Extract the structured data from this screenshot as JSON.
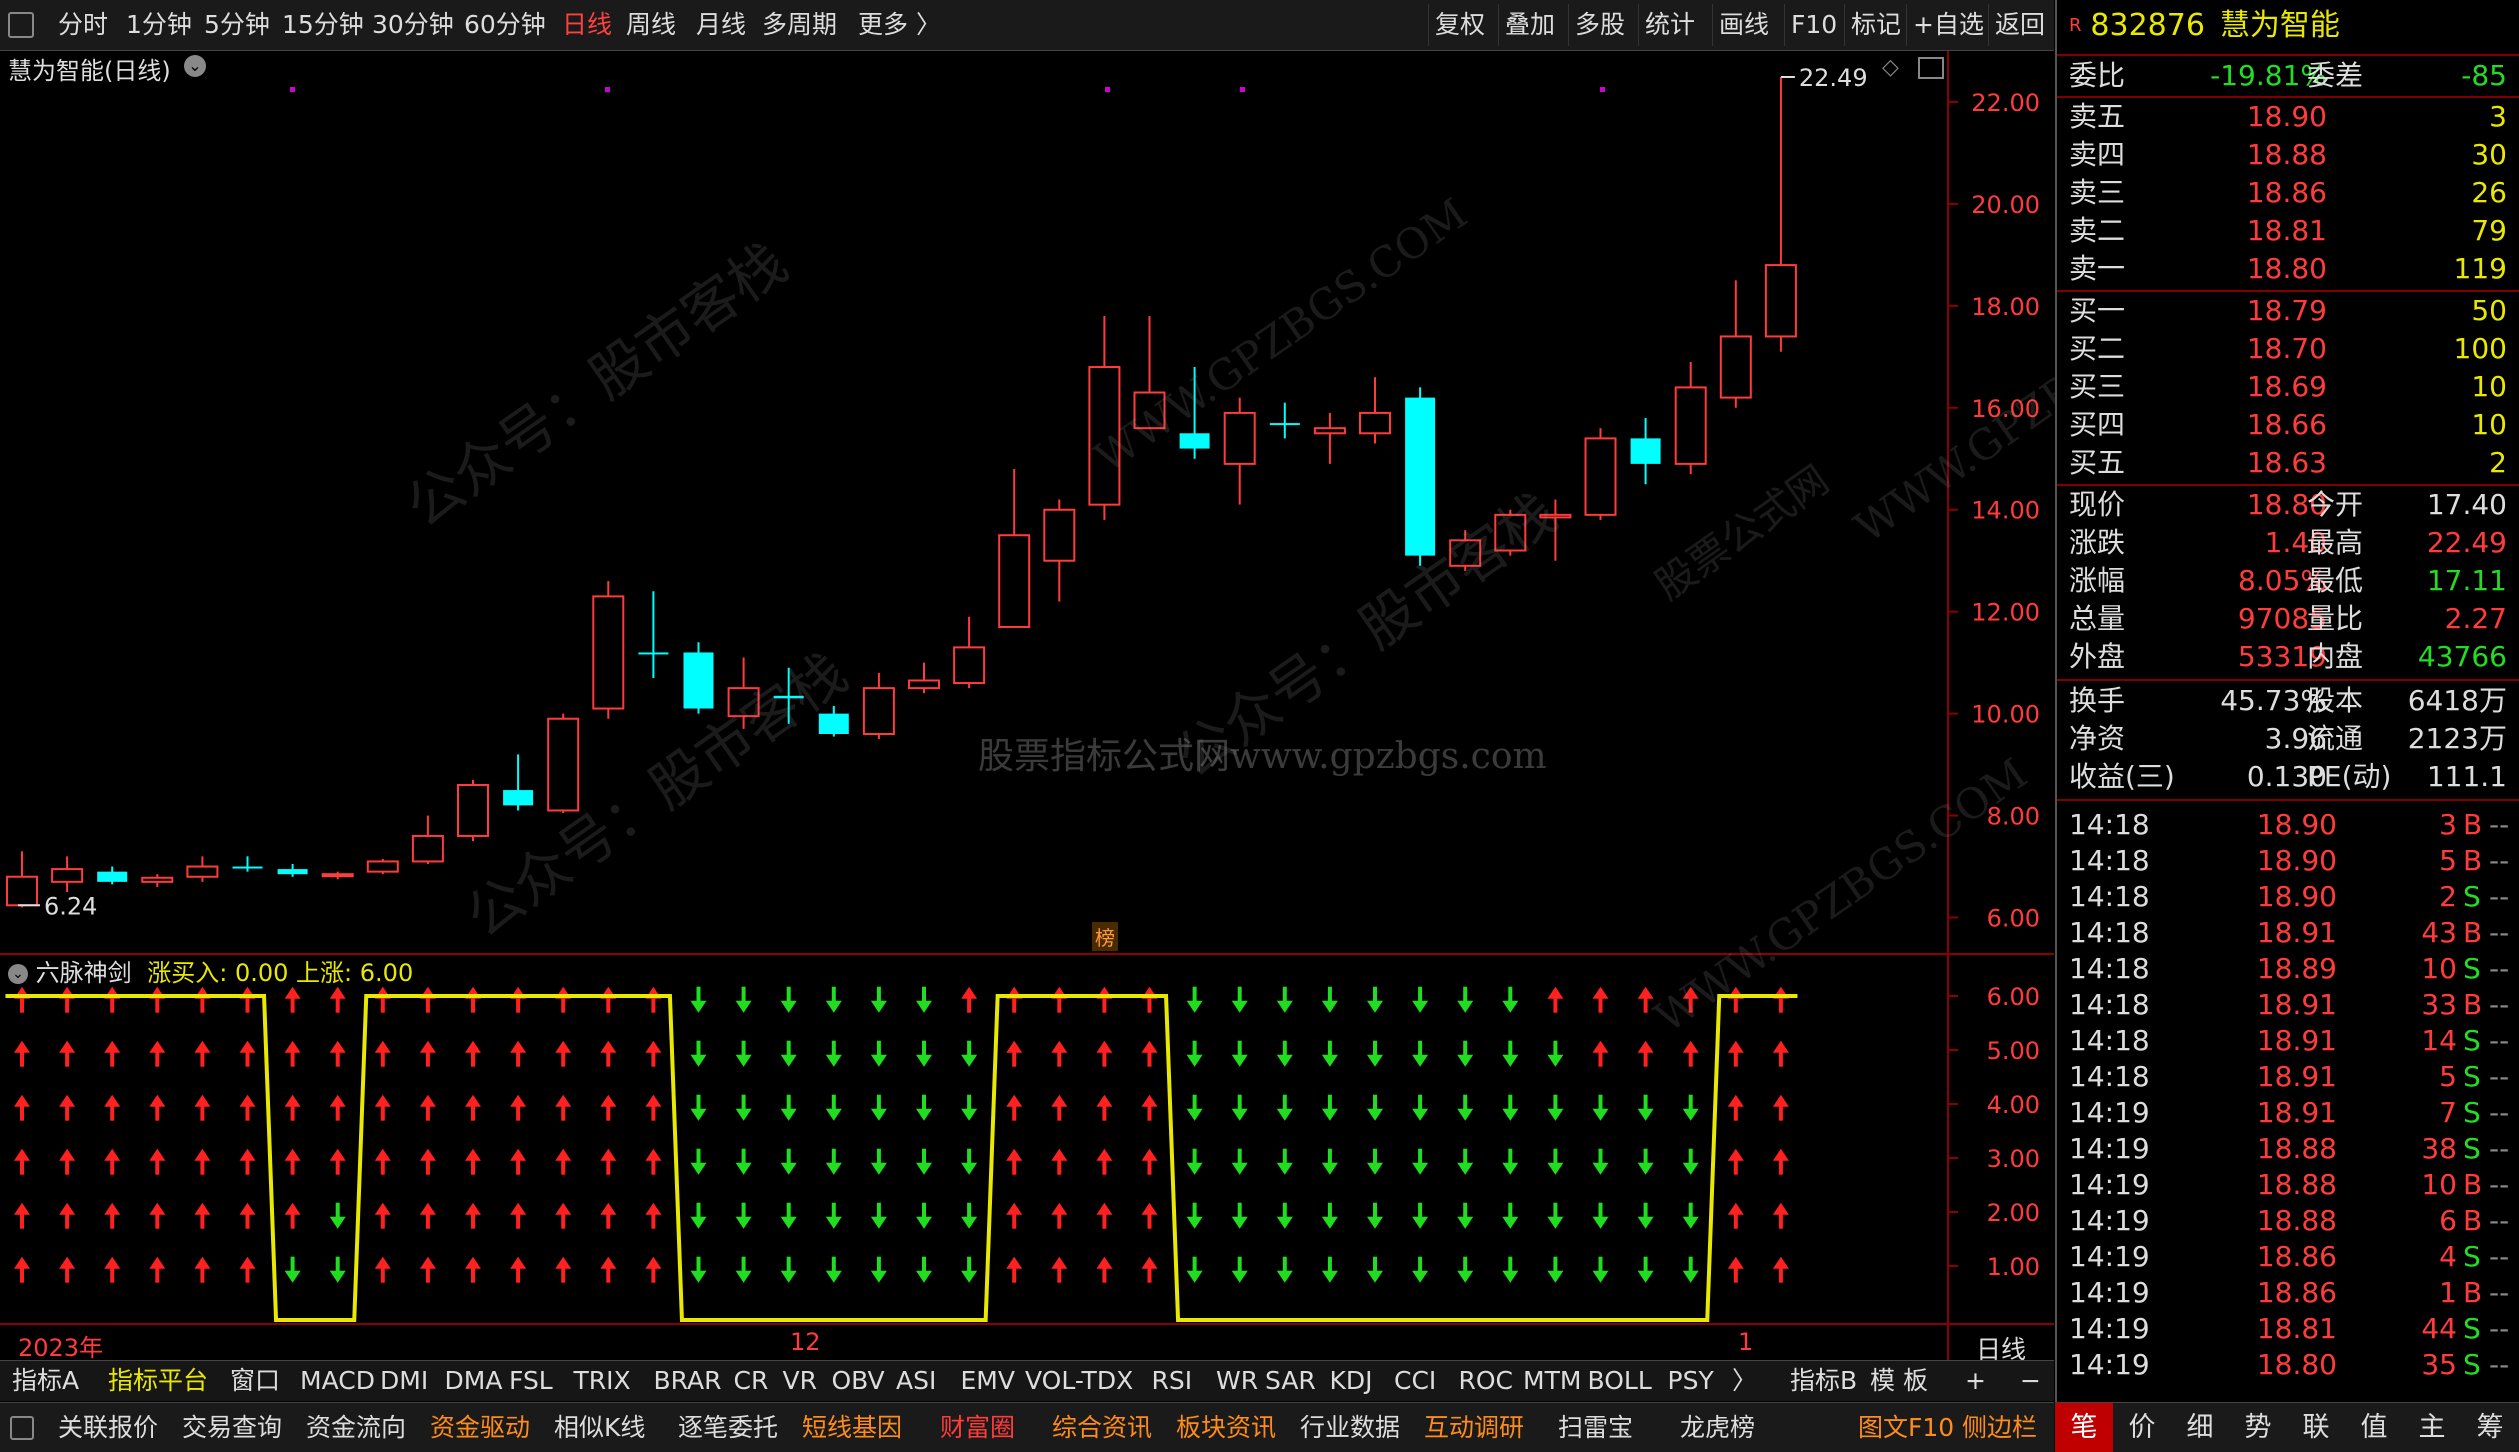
{
  "periods": [
    "分时",
    "1分钟",
    "5分钟",
    "15分钟",
    "30分钟",
    "60分钟",
    "日线",
    "周线",
    "月线",
    "多周期",
    "更多 〉"
  ],
  "active_period": "日线",
  "tools": [
    "复权",
    "叠加",
    "多股",
    "统计",
    "画线",
    "F10",
    "标记",
    "+自选",
    "返回"
  ],
  "chart_title": "慧为智能(日线)",
  "main_y_ticks": [
    "22.00",
    "20.00",
    "18.00",
    "16.00",
    "14.00",
    "12.00",
    "10.00",
    "8.00",
    "6.00"
  ],
  "high_label": "22.49",
  "low_label": "6.24",
  "watermark_center": "股票指标公式网www.gpzbgs.com",
  "watermarks": [
    "公众号：股市客栈",
    "WWW.GPZBGS.COM",
    "股票公式网"
  ],
  "bang_label": "榜",
  "indicator_title": "六脉神剑",
  "indicator_values": "涨买入: 0.00  上涨: 6.00",
  "ind_y_ticks": [
    "6.00",
    "5.00",
    "4.00",
    "3.00",
    "2.00",
    "1.00"
  ],
  "date_labels": {
    "start": "2023年",
    "mid": "12",
    "end": "1"
  },
  "date_tab": "日线",
  "chart_data": {
    "type": "candlestick",
    "ylim": [
      5.5,
      23
    ],
    "candles": [
      {
        "o": 6.24,
        "h": 7.3,
        "l": 6.2,
        "c": 6.8,
        "up": true
      },
      {
        "o": 6.7,
        "h": 7.2,
        "l": 6.5,
        "c": 6.95,
        "up": true
      },
      {
        "o": 6.9,
        "h": 7.0,
        "l": 6.65,
        "c": 6.7,
        "up": false
      },
      {
        "o": 6.7,
        "h": 6.85,
        "l": 6.6,
        "c": 6.78,
        "up": true
      },
      {
        "o": 6.8,
        "h": 7.2,
        "l": 6.7,
        "c": 7.0,
        "up": true
      },
      {
        "o": 7.0,
        "h": 7.2,
        "l": 6.9,
        "c": 7.0,
        "up": false
      },
      {
        "o": 6.95,
        "h": 7.05,
        "l": 6.8,
        "c": 6.85,
        "up": false
      },
      {
        "o": 6.82,
        "h": 6.9,
        "l": 6.75,
        "c": 6.85,
        "up": true
      },
      {
        "o": 6.9,
        "h": 7.15,
        "l": 6.85,
        "c": 7.1,
        "up": true
      },
      {
        "o": 7.1,
        "h": 8.0,
        "l": 7.05,
        "c": 7.6,
        "up": true
      },
      {
        "o": 7.6,
        "h": 8.7,
        "l": 7.5,
        "c": 8.6,
        "up": true
      },
      {
        "o": 8.5,
        "h": 9.2,
        "l": 8.1,
        "c": 8.2,
        "up": false
      },
      {
        "o": 8.1,
        "h": 10.0,
        "l": 8.05,
        "c": 9.9,
        "up": true
      },
      {
        "o": 10.1,
        "h": 12.6,
        "l": 9.9,
        "c": 12.3,
        "up": true
      },
      {
        "o": 11.2,
        "h": 12.4,
        "l": 10.7,
        "c": 11.2,
        "up": false
      },
      {
        "o": 11.2,
        "h": 11.4,
        "l": 10.0,
        "c": 10.1,
        "up": false
      },
      {
        "o": 9.95,
        "h": 11.1,
        "l": 9.7,
        "c": 10.5,
        "up": true
      },
      {
        "o": 10.35,
        "h": 10.9,
        "l": 9.8,
        "c": 10.3,
        "up": false
      },
      {
        "o": 10.0,
        "h": 10.15,
        "l": 9.55,
        "c": 9.6,
        "up": false
      },
      {
        "o": 9.6,
        "h": 10.8,
        "l": 9.5,
        "c": 10.5,
        "up": true
      },
      {
        "o": 10.5,
        "h": 11.0,
        "l": 10.4,
        "c": 10.65,
        "up": true
      },
      {
        "o": 10.6,
        "h": 11.9,
        "l": 10.5,
        "c": 11.3,
        "up": true
      },
      {
        "o": 11.7,
        "h": 14.8,
        "l": 11.7,
        "c": 13.5,
        "up": true
      },
      {
        "o": 13.0,
        "h": 14.2,
        "l": 12.2,
        "c": 14.0,
        "up": true
      },
      {
        "o": 14.1,
        "h": 17.8,
        "l": 13.8,
        "c": 16.8,
        "up": true
      },
      {
        "o": 15.6,
        "h": 17.8,
        "l": 15.6,
        "c": 16.3,
        "up": true
      },
      {
        "o": 15.5,
        "h": 16.8,
        "l": 15.0,
        "c": 15.2,
        "up": false
      },
      {
        "o": 14.9,
        "h": 16.2,
        "l": 14.1,
        "c": 15.9,
        "up": true
      },
      {
        "o": 15.7,
        "h": 16.1,
        "l": 15.4,
        "c": 15.7,
        "up": false
      },
      {
        "o": 15.6,
        "h": 15.9,
        "l": 14.9,
        "c": 15.5,
        "up": true
      },
      {
        "o": 15.5,
        "h": 16.6,
        "l": 15.3,
        "c": 15.9,
        "up": true
      },
      {
        "o": 16.2,
        "h": 16.4,
        "l": 12.9,
        "c": 13.1,
        "up": false
      },
      {
        "o": 12.9,
        "h": 13.6,
        "l": 12.8,
        "c": 13.4,
        "up": true
      },
      {
        "o": 13.2,
        "h": 14.0,
        "l": 13.1,
        "c": 13.9,
        "up": true
      },
      {
        "o": 13.85,
        "h": 14.2,
        "l": 13.0,
        "c": 13.9,
        "up": true
      },
      {
        "o": 13.9,
        "h": 15.6,
        "l": 13.8,
        "c": 15.4,
        "up": true
      },
      {
        "o": 15.4,
        "h": 15.8,
        "l": 14.5,
        "c": 14.9,
        "up": false
      },
      {
        "o": 14.9,
        "h": 16.9,
        "l": 14.7,
        "c": 16.4,
        "up": true
      },
      {
        "o": 16.2,
        "h": 18.5,
        "l": 16.0,
        "c": 17.4,
        "up": true
      },
      {
        "o": 17.4,
        "h": 22.49,
        "l": 17.1,
        "c": 18.8,
        "up": true
      }
    ],
    "indicator": {
      "name": "六脉神剑",
      "ylim": [
        0,
        6
      ],
      "values": [
        6,
        6,
        6,
        6,
        6,
        6,
        0,
        0,
        6,
        6,
        6,
        6,
        6,
        6,
        6,
        0,
        0,
        0,
        0,
        0,
        0,
        0,
        6,
        6,
        6,
        6,
        0,
        0,
        0,
        0,
        0,
        0,
        0,
        0,
        0,
        0,
        0,
        0,
        6,
        6
      ],
      "red_counts": [
        6,
        6,
        6,
        6,
        6,
        6,
        5,
        4,
        6,
        6,
        6,
        6,
        6,
        6,
        6,
        0,
        0,
        0,
        0,
        0,
        0,
        1,
        6,
        6,
        6,
        6,
        0,
        0,
        0,
        0,
        0,
        0,
        0,
        0,
        1,
        2,
        2,
        2,
        6,
        6
      ]
    }
  },
  "quote": {
    "code": "832876",
    "name": "慧为智能",
    "weibi_label": "委比",
    "weibi": "-19.81%",
    "weicha_label": "委差",
    "weicha": "-85",
    "asks": [
      {
        "label": "卖五",
        "price": "18.90",
        "vol": "3"
      },
      {
        "label": "卖四",
        "price": "18.88",
        "vol": "30"
      },
      {
        "label": "卖三",
        "price": "18.86",
        "vol": "26"
      },
      {
        "label": "卖二",
        "price": "18.81",
        "vol": "79"
      },
      {
        "label": "卖一",
        "price": "18.80",
        "vol": "119"
      }
    ],
    "bids": [
      {
        "label": "买一",
        "price": "18.79",
        "vol": "50"
      },
      {
        "label": "买二",
        "price": "18.70",
        "vol": "100"
      },
      {
        "label": "买三",
        "price": "18.69",
        "vol": "10"
      },
      {
        "label": "买四",
        "price": "18.66",
        "vol": "10"
      },
      {
        "label": "买五",
        "price": "18.63",
        "vol": "2"
      }
    ],
    "stats": [
      {
        "l1": "现价",
        "v1": "18.80",
        "c1": "red",
        "l2": "今开",
        "v2": "17.40",
        "c2": "white"
      },
      {
        "l1": "涨跌",
        "v1": "1.40",
        "c1": "red",
        "l2": "最高",
        "v2": "22.49",
        "c2": "red"
      },
      {
        "l1": "涨幅",
        "v1": "8.05%",
        "c1": "red",
        "l2": "最低",
        "v2": "17.11",
        "c2": "green"
      },
      {
        "l1": "总量",
        "v1": "97085",
        "c1": "red",
        "l2": "量比",
        "v2": "2.27",
        "c2": "red"
      },
      {
        "l1": "外盘",
        "v1": "53319",
        "c1": "red",
        "l2": "内盘",
        "v2": "43766",
        "c2": "green"
      }
    ],
    "stats2": [
      {
        "l1": "换手",
        "v1": "45.73%",
        "l2": "股本",
        "v2": "6418万"
      },
      {
        "l1": "净资",
        "v1": "3.96",
        "l2": "流通",
        "v2": "2123万"
      },
      {
        "l1": "收益(三)",
        "v1": "0.130",
        "l2": "PE(动)",
        "v2": "111.1"
      }
    ],
    "ticks": [
      {
        "t": "14:18",
        "p": "18.90",
        "v": "3",
        "s": "B"
      },
      {
        "t": "14:18",
        "p": "18.90",
        "v": "5",
        "s": "B"
      },
      {
        "t": "14:18",
        "p": "18.90",
        "v": "2",
        "s": "S"
      },
      {
        "t": "14:18",
        "p": "18.91",
        "v": "43",
        "s": "B"
      },
      {
        "t": "14:18",
        "p": "18.89",
        "v": "10",
        "s": "S"
      },
      {
        "t": "14:18",
        "p": "18.91",
        "v": "33",
        "s": "B"
      },
      {
        "t": "14:18",
        "p": "18.91",
        "v": "14",
        "s": "S"
      },
      {
        "t": "14:18",
        "p": "18.91",
        "v": "5",
        "s": "S"
      },
      {
        "t": "14:19",
        "p": "18.91",
        "v": "7",
        "s": "S"
      },
      {
        "t": "14:19",
        "p": "18.88",
        "v": "38",
        "s": "S"
      },
      {
        "t": "14:19",
        "p": "18.88",
        "v": "10",
        "s": "B"
      },
      {
        "t": "14:19",
        "p": "18.88",
        "v": "6",
        "s": "B"
      },
      {
        "t": "14:19",
        "p": "18.86",
        "v": "4",
        "s": "S"
      },
      {
        "t": "14:19",
        "p": "18.86",
        "v": "1",
        "s": "B"
      },
      {
        "t": "14:19",
        "p": "18.81",
        "v": "44",
        "s": "S"
      },
      {
        "t": "14:19",
        "p": "18.80",
        "v": "35",
        "s": "S"
      }
    ],
    "tick_dash": "--"
  },
  "indicator_tabs": [
    "指标A",
    "指标平台",
    "窗口",
    "MACD",
    "DMI",
    "DMA",
    "FSL",
    "TRIX",
    "BRAR",
    "CR",
    "VR",
    "OBV",
    "ASI",
    "EMV",
    "VOL-TDX",
    "RSI",
    "WR",
    "SAR",
    "KDJ",
    "CCI",
    "ROC",
    "MTM",
    "BOLL",
    "PSY",
    "〉"
  ],
  "indicator_right": [
    "指标B",
    "模 板",
    "+",
    "−"
  ],
  "func_tabs": [
    "关联报价",
    "交易查询",
    "资金流向",
    "资金驱动",
    "相似K线",
    "逐笔委托",
    "短线基因",
    "财富圈",
    "综合资讯",
    "板块资讯",
    "行业数据",
    "互动调研",
    "扫雷宝",
    "龙虎榜",
    "图文F10",
    "侧边栏"
  ],
  "bottom_tabs": [
    "笔",
    "价",
    "细",
    "势",
    "联",
    "值",
    "主",
    "筹"
  ],
  "colors": {
    "up": "#ff3b3b",
    "down": "#00ffff",
    "ind_line": "#e8e800",
    "grid": "#8b0000",
    "up_arrow": "#ff2020",
    "down_arrow": "#20dd20"
  }
}
